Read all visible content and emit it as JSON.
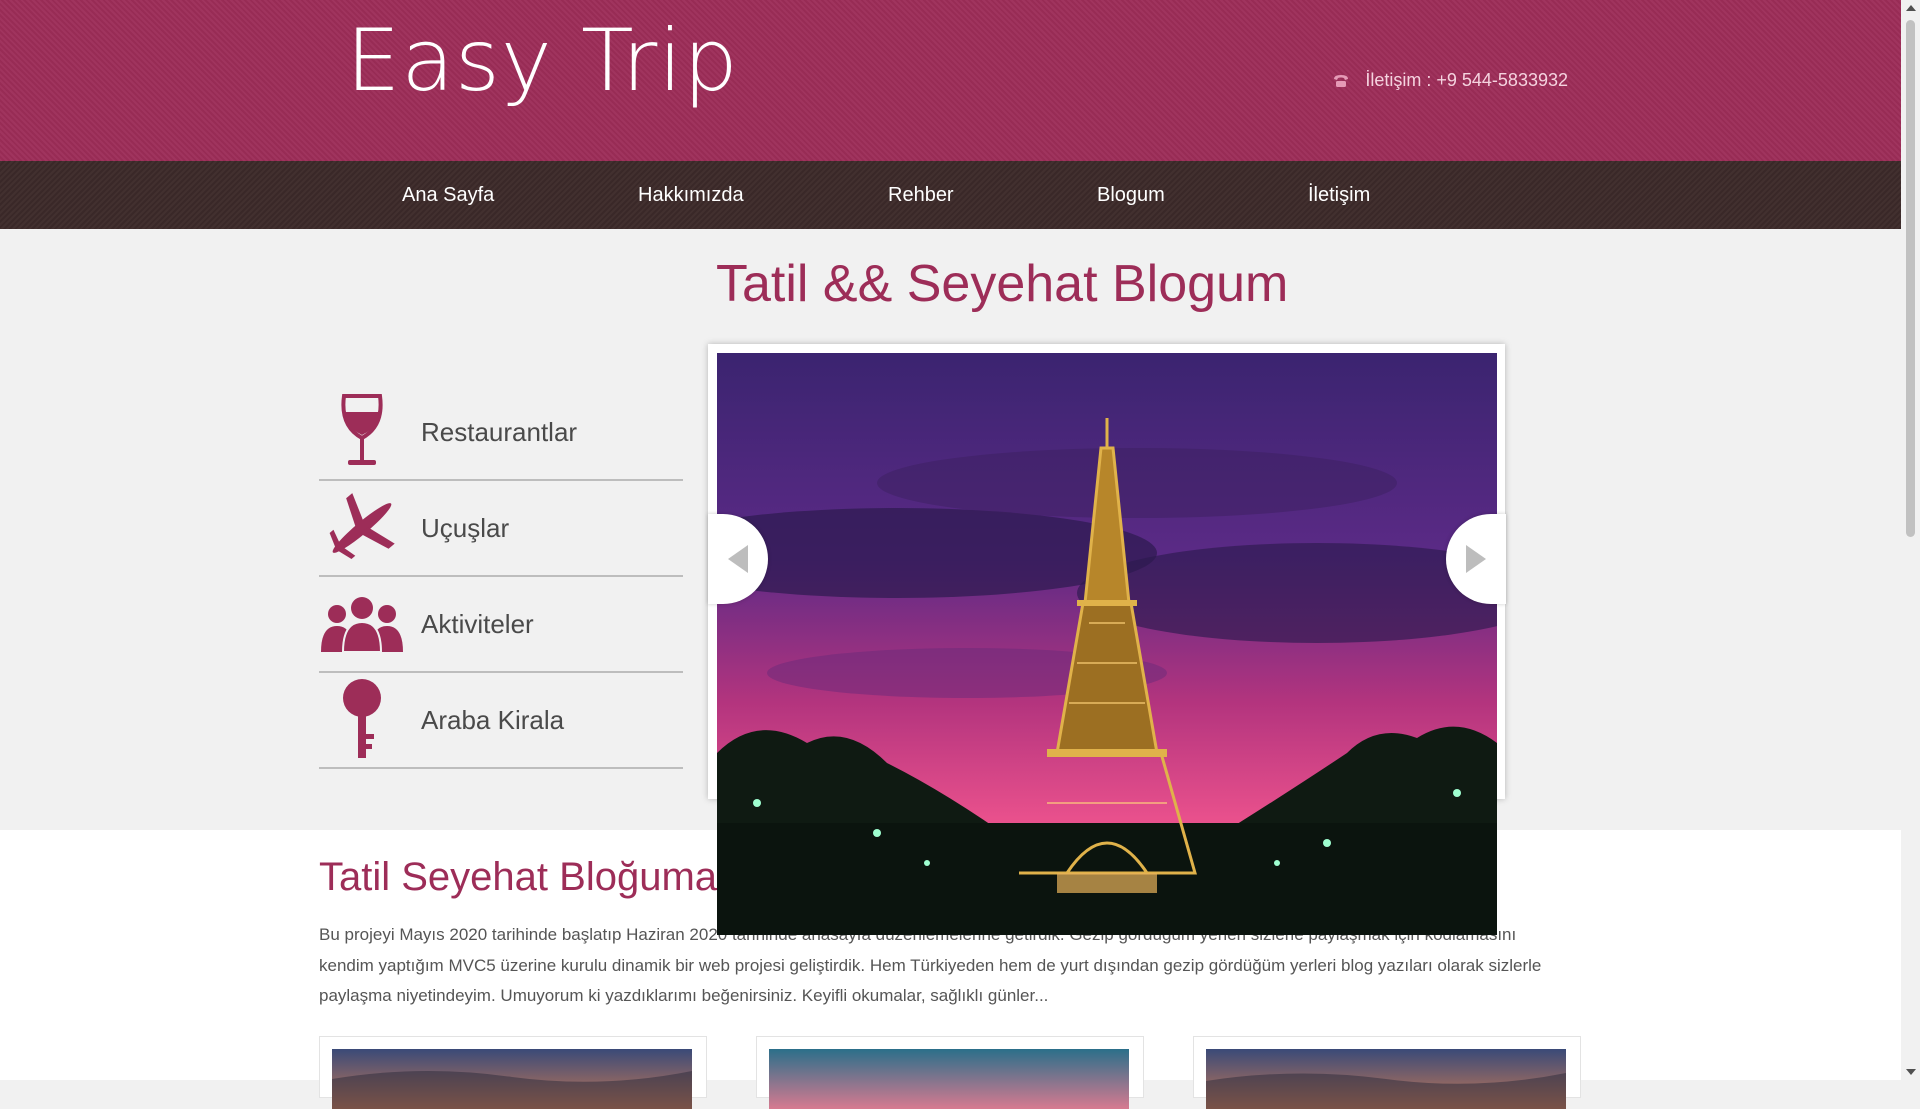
{
  "brand": {
    "logo": "Easy Trip",
    "accent": "#9d2d58",
    "nav_bg": "#3d2b2a"
  },
  "header": {
    "contact_text": "İletişim : +9 544-5833932",
    "contact_icon": "phone-icon"
  },
  "nav": [
    {
      "label": "Ana Sayfa"
    },
    {
      "label": "Hakkımızda"
    },
    {
      "label": "Rehber"
    },
    {
      "label": "Blogum"
    },
    {
      "label": "İletişim"
    }
  ],
  "main": {
    "title": "Tatil && Seyehat Blogum",
    "sidebar": [
      {
        "label": "Restaurantlar",
        "icon": "wine-glass-icon"
      },
      {
        "label": "Uçuşlar",
        "icon": "airplane-icon"
      },
      {
        "label": "Aktiviteler",
        "icon": "people-group-icon"
      },
      {
        "label": "Araba Kirala",
        "icon": "key-icon"
      }
    ],
    "slider": {
      "image": "eiffel-tower-sunset"
    }
  },
  "welcome": {
    "title": "Tatil Seyehat Bloğuma",
    "text": "Bu projeyi Mayıs 2020 tarihinde başlatıp Haziran 2020 tarihinde anasayfa düzenlemelerine getirdik. Gezip gördüğüm yerleri sizlerle paylaşmak için kodlamasını kendim yaptığım MVC5 üzerine kurulu dinamik bir web projesi geliştirdik. Hem Türkiyeden hem de yurt dışından gezip gördüğüm yerleri blog yazıları olarak sizlerle paylaşma niyetindeyim. Umuyorum ki yazdıklarımı beğenirsiniz. Keyifli okumalar, sağlıklı günler..."
  }
}
